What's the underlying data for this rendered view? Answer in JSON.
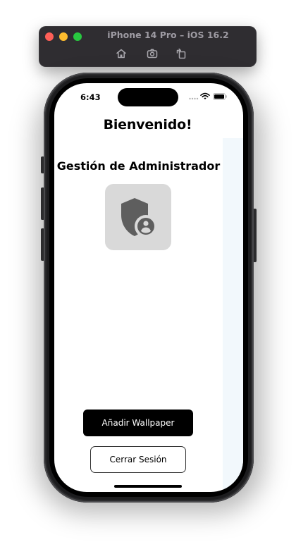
{
  "simulator": {
    "title": "iPhone 14 Pro – iOS 16.2",
    "toolbar_icons": [
      "home-icon",
      "screenshot-icon",
      "rotate-icon"
    ]
  },
  "status_bar": {
    "time": "6:43",
    "icons": [
      "cellular-signal-icon",
      "wifi-icon",
      "battery-icon"
    ]
  },
  "app": {
    "welcome": "Bienvenido!",
    "admin_section": {
      "title": "Gestión de Administrador",
      "icon": "admin-shield-person-icon"
    },
    "buttons": {
      "add_wallpaper": "Añadir Wallpaper",
      "logout": "Cerrar Sesión"
    }
  },
  "colors": {
    "primary_button": "#000000",
    "tile_background": "#d9d9d9",
    "side_panel": "#f2f8fc",
    "icon_gray": "#5e5e5e"
  }
}
